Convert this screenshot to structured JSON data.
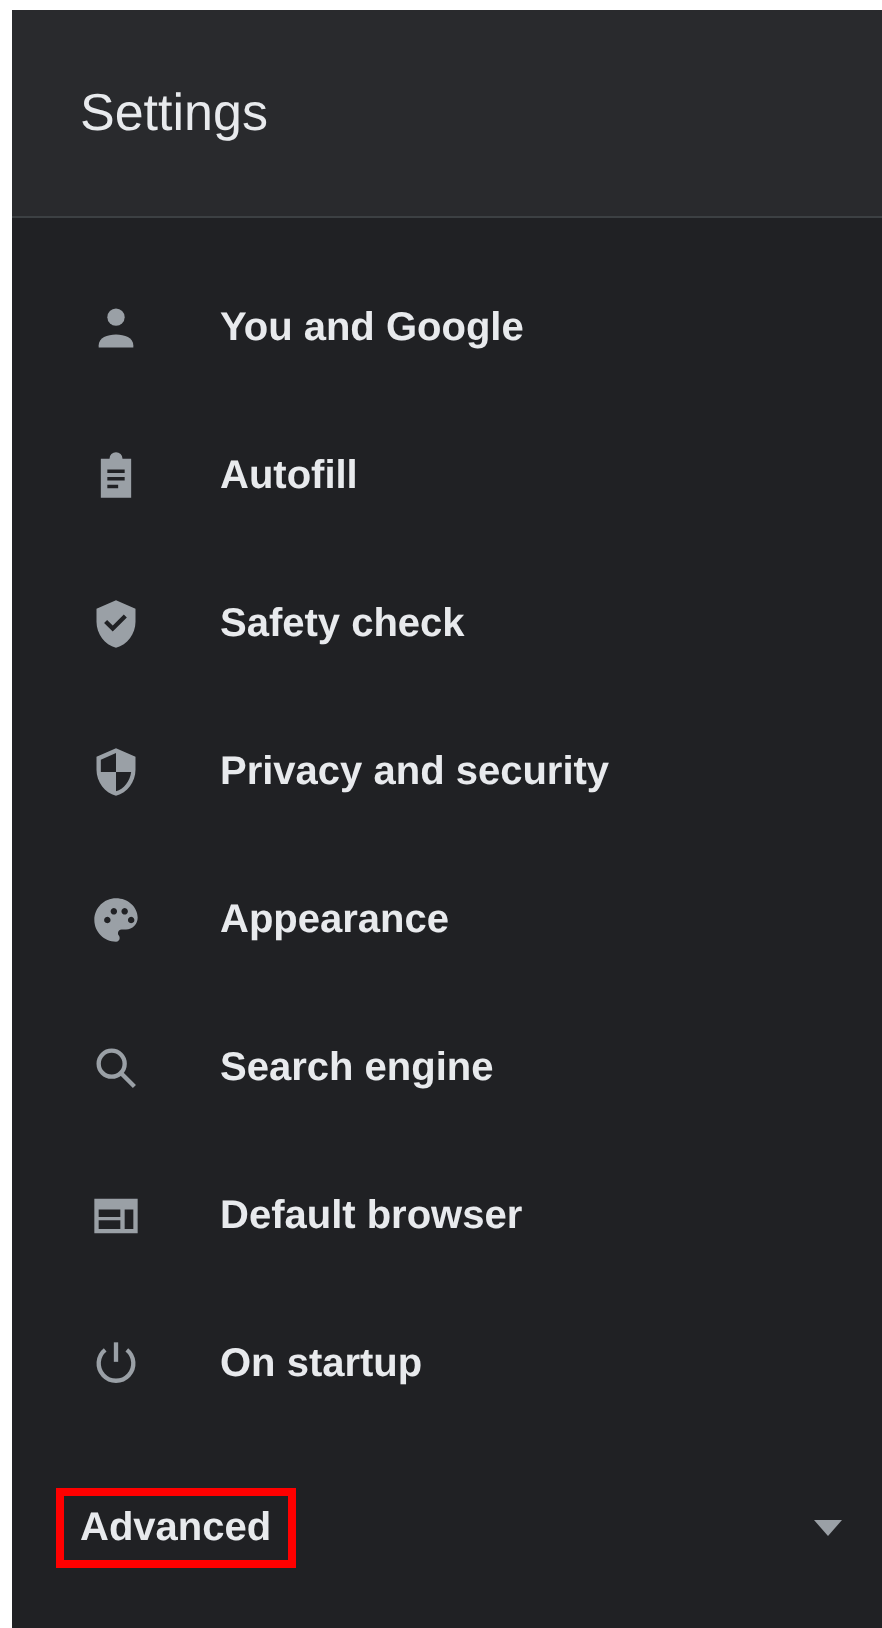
{
  "header": {
    "title": "Settings"
  },
  "menu": [
    {
      "label": "You and Google",
      "kind": "person"
    },
    {
      "label": "Autofill",
      "kind": "clipboard"
    },
    {
      "label": "Safety check",
      "kind": "shield-check"
    },
    {
      "label": "Privacy and security",
      "kind": "shield-half"
    },
    {
      "label": "Appearance",
      "kind": "palette"
    },
    {
      "label": "Search engine",
      "kind": "search"
    },
    {
      "label": "Default browser",
      "kind": "browser"
    },
    {
      "label": "On startup",
      "kind": "power"
    }
  ],
  "advanced": {
    "label": "Advanced",
    "expanded": false,
    "highlighted": true
  }
}
